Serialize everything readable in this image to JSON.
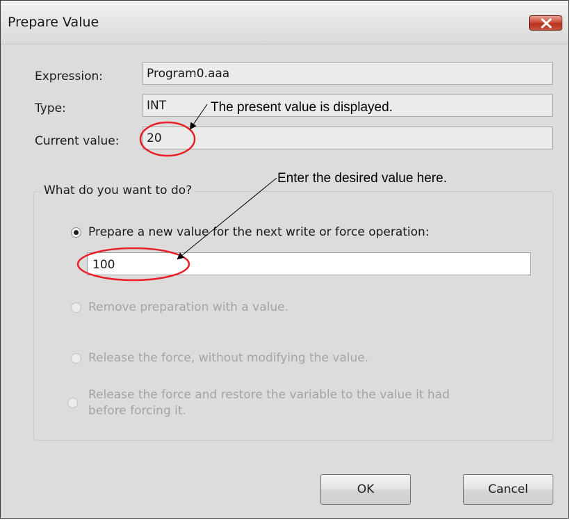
{
  "window": {
    "title": "Prepare Value",
    "close_icon": "close-icon"
  },
  "fields": {
    "expression_label": "Expression:",
    "expression_value": "Program0.aaa",
    "type_label": "Type:",
    "type_value": "INT",
    "current_label": "Current value:",
    "current_value": "20"
  },
  "group": {
    "legend": "What do you want to do?",
    "options": [
      {
        "label": "Prepare a new value for the next write or force operation:",
        "checked": true,
        "enabled": true
      },
      {
        "label": "Remove preparation with a value.",
        "checked": false,
        "enabled": false
      },
      {
        "label": "Release the force, without modifying the value.",
        "checked": false,
        "enabled": false
      },
      {
        "label_line1": "Release the force and restore the variable to the value it had",
        "label_line2": "before forcing it.",
        "checked": false,
        "enabled": false
      }
    ],
    "new_value": "100"
  },
  "buttons": {
    "ok": "OK",
    "cancel": "Cancel"
  },
  "callouts": {
    "present": "The present value is displayed.",
    "enter": "Enter the desired value here."
  },
  "colors": {
    "annotation_ellipse": "#e8202a",
    "close_button": "#c9533f"
  }
}
